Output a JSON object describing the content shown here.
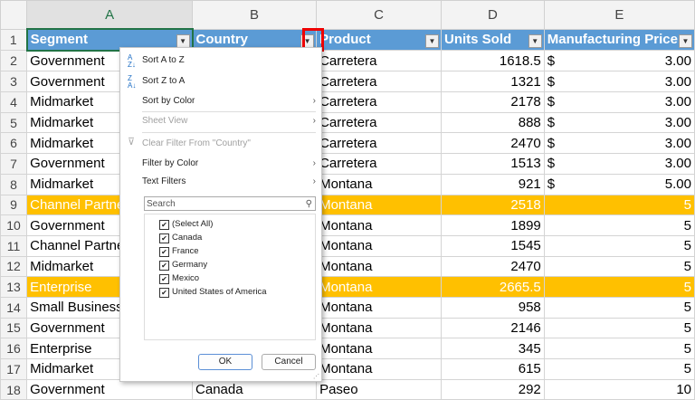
{
  "columns": [
    "A",
    "B",
    "C",
    "D",
    "E"
  ],
  "headers": [
    "Segment",
    "Country",
    "Product",
    "Units Sold",
    "Manufacturing Price"
  ],
  "rows": [
    {
      "n": "2",
      "a": "Government",
      "b": "",
      "c": "Carretera",
      "d": "1618.5",
      "e": "3.00",
      "cur": true
    },
    {
      "n": "3",
      "a": "Government",
      "b": "",
      "c": "Carretera",
      "d": "1321",
      "e": "3.00",
      "cur": true
    },
    {
      "n": "4",
      "a": "Midmarket",
      "b": "",
      "c": "Carretera",
      "d": "2178",
      "e": "3.00",
      "cur": true
    },
    {
      "n": "5",
      "a": "Midmarket",
      "b": "",
      "c": "Carretera",
      "d": "888",
      "e": "3.00",
      "cur": true
    },
    {
      "n": "6",
      "a": "Midmarket",
      "b": "",
      "c": "Carretera",
      "d": "2470",
      "e": "3.00",
      "cur": true
    },
    {
      "n": "7",
      "a": "Government",
      "b": "",
      "c": "Carretera",
      "d": "1513",
      "e": "3.00",
      "cur": true
    },
    {
      "n": "8",
      "a": "Midmarket",
      "b": "",
      "c": "Montana",
      "d": "921",
      "e": "5.00",
      "cur": true
    },
    {
      "n": "9",
      "a": "Channel Partners",
      "b": "",
      "c": "Montana",
      "d": "2518",
      "e": "5",
      "hl": true
    },
    {
      "n": "10",
      "a": "Government",
      "b": "",
      "c": "Montana",
      "d": "1899",
      "e": "5"
    },
    {
      "n": "11",
      "a": "Channel Partners",
      "b": "",
      "c": "Montana",
      "d": "1545",
      "e": "5"
    },
    {
      "n": "12",
      "a": "Midmarket",
      "b": "",
      "c": "Montana",
      "d": "2470",
      "e": "5"
    },
    {
      "n": "13",
      "a": "Enterprise",
      "b": "",
      "c": "Montana",
      "d": "2665.5",
      "e": "5",
      "hl": true
    },
    {
      "n": "14",
      "a": "Small Business",
      "b": "",
      "c": "Montana",
      "d": "958",
      "e": "5"
    },
    {
      "n": "15",
      "a": "Government",
      "b": "",
      "c": "Montana",
      "d": "2146",
      "e": "5"
    },
    {
      "n": "16",
      "a": "Enterprise",
      "b": "",
      "c": "Montana",
      "d": "345",
      "e": "5"
    },
    {
      "n": "17",
      "a": "Midmarket",
      "b": "",
      "c": "Montana",
      "d": "615",
      "e": "5"
    },
    {
      "n": "18",
      "a": "Government",
      "b": "Canada",
      "c": "Paseo",
      "d": "292",
      "e": "10"
    }
  ],
  "currency": "$",
  "menu": {
    "sort_az": "Sort A to Z",
    "sort_za": "Sort Z to A",
    "sort_color": "Sort by Color",
    "sheet_view": "Sheet View",
    "clear_filter": "Clear Filter From \"Country\"",
    "filter_color": "Filter by Color",
    "text_filters": "Text Filters",
    "search_placeholder": "Search",
    "items": [
      "(Select All)",
      "Canada",
      "France",
      "Germany",
      "Mexico",
      "United States of America"
    ],
    "ok": "OK",
    "cancel": "Cancel"
  }
}
